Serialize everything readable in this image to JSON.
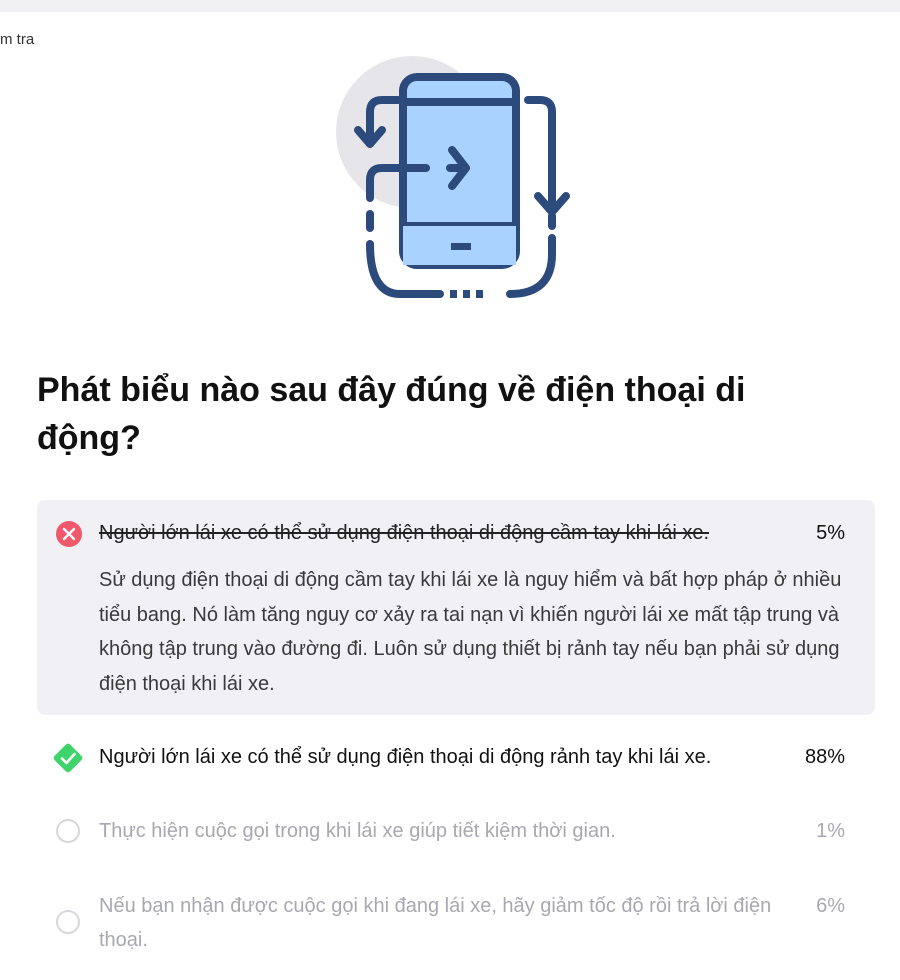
{
  "breadcrumb": "m tra",
  "question": "Phát biểu nào sau đây đúng về điện thoại di động?",
  "options": [
    {
      "text": "Người lớn lái xe có thể sử dụng điện thoại di động cầm tay khi lái xe.",
      "percent": "5%",
      "state": "incorrect",
      "explanation": "Sử dụng điện thoại di động cầm tay khi lái xe là nguy hiểm và bất hợp pháp ở nhiều tiểu bang. Nó làm tăng nguy cơ xảy ra tai nạn vì khiến người lái xe mất tập trung và không tập trung vào đường đi. Luôn sử dụng thiết bị rảnh tay nếu bạn phải sử dụng điện thoại khi lái xe."
    },
    {
      "text": "Người lớn lái xe có thể sử dụng điện thoại di động rảnh tay khi lái xe.",
      "percent": "88%",
      "state": "correct"
    },
    {
      "text": "Thực hiện cuộc gọi trong khi lái xe giúp tiết kiệm thời gian.",
      "percent": "1%",
      "state": "unselected"
    },
    {
      "text": "Nếu bạn nhận được cuộc gọi khi đang lái xe, hãy giảm tốc độ rồi trả lời điện thoại.",
      "percent": "6%",
      "state": "unselected"
    }
  ],
  "colors": {
    "incorrect": "#f0596b",
    "correct": "#3fd46b",
    "phone_frame": "#2d4a7c",
    "phone_screen": "#a9d2ff",
    "option_bg": "#f0f0f5"
  },
  "icons": [
    "phone-rotate-icon",
    "error-icon",
    "check-diamond-icon",
    "radio-icon"
  ]
}
